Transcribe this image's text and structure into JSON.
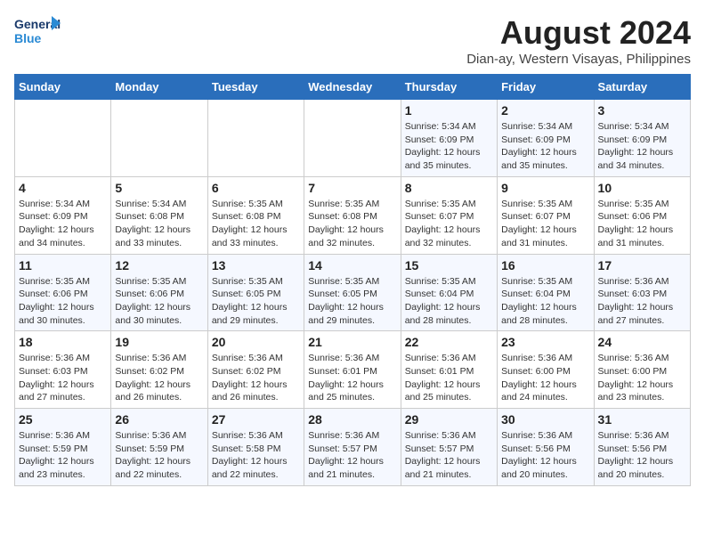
{
  "header": {
    "logo_line1": "General",
    "logo_line2": "Blue",
    "title": "August 2024",
    "subtitle": "Dian-ay, Western Visayas, Philippines"
  },
  "days_of_week": [
    "Sunday",
    "Monday",
    "Tuesday",
    "Wednesday",
    "Thursday",
    "Friday",
    "Saturday"
  ],
  "weeks": [
    [
      {
        "date": "",
        "info": ""
      },
      {
        "date": "",
        "info": ""
      },
      {
        "date": "",
        "info": ""
      },
      {
        "date": "",
        "info": ""
      },
      {
        "date": "1",
        "info": "Sunrise: 5:34 AM\nSunset: 6:09 PM\nDaylight: 12 hours\nand 35 minutes."
      },
      {
        "date": "2",
        "info": "Sunrise: 5:34 AM\nSunset: 6:09 PM\nDaylight: 12 hours\nand 35 minutes."
      },
      {
        "date": "3",
        "info": "Sunrise: 5:34 AM\nSunset: 6:09 PM\nDaylight: 12 hours\nand 34 minutes."
      }
    ],
    [
      {
        "date": "4",
        "info": "Sunrise: 5:34 AM\nSunset: 6:09 PM\nDaylight: 12 hours\nand 34 minutes."
      },
      {
        "date": "5",
        "info": "Sunrise: 5:34 AM\nSunset: 6:08 PM\nDaylight: 12 hours\nand 33 minutes."
      },
      {
        "date": "6",
        "info": "Sunrise: 5:35 AM\nSunset: 6:08 PM\nDaylight: 12 hours\nand 33 minutes."
      },
      {
        "date": "7",
        "info": "Sunrise: 5:35 AM\nSunset: 6:08 PM\nDaylight: 12 hours\nand 32 minutes."
      },
      {
        "date": "8",
        "info": "Sunrise: 5:35 AM\nSunset: 6:07 PM\nDaylight: 12 hours\nand 32 minutes."
      },
      {
        "date": "9",
        "info": "Sunrise: 5:35 AM\nSunset: 6:07 PM\nDaylight: 12 hours\nand 31 minutes."
      },
      {
        "date": "10",
        "info": "Sunrise: 5:35 AM\nSunset: 6:06 PM\nDaylight: 12 hours\nand 31 minutes."
      }
    ],
    [
      {
        "date": "11",
        "info": "Sunrise: 5:35 AM\nSunset: 6:06 PM\nDaylight: 12 hours\nand 30 minutes."
      },
      {
        "date": "12",
        "info": "Sunrise: 5:35 AM\nSunset: 6:06 PM\nDaylight: 12 hours\nand 30 minutes."
      },
      {
        "date": "13",
        "info": "Sunrise: 5:35 AM\nSunset: 6:05 PM\nDaylight: 12 hours\nand 29 minutes."
      },
      {
        "date": "14",
        "info": "Sunrise: 5:35 AM\nSunset: 6:05 PM\nDaylight: 12 hours\nand 29 minutes."
      },
      {
        "date": "15",
        "info": "Sunrise: 5:35 AM\nSunset: 6:04 PM\nDaylight: 12 hours\nand 28 minutes."
      },
      {
        "date": "16",
        "info": "Sunrise: 5:35 AM\nSunset: 6:04 PM\nDaylight: 12 hours\nand 28 minutes."
      },
      {
        "date": "17",
        "info": "Sunrise: 5:36 AM\nSunset: 6:03 PM\nDaylight: 12 hours\nand 27 minutes."
      }
    ],
    [
      {
        "date": "18",
        "info": "Sunrise: 5:36 AM\nSunset: 6:03 PM\nDaylight: 12 hours\nand 27 minutes."
      },
      {
        "date": "19",
        "info": "Sunrise: 5:36 AM\nSunset: 6:02 PM\nDaylight: 12 hours\nand 26 minutes."
      },
      {
        "date": "20",
        "info": "Sunrise: 5:36 AM\nSunset: 6:02 PM\nDaylight: 12 hours\nand 26 minutes."
      },
      {
        "date": "21",
        "info": "Sunrise: 5:36 AM\nSunset: 6:01 PM\nDaylight: 12 hours\nand 25 minutes."
      },
      {
        "date": "22",
        "info": "Sunrise: 5:36 AM\nSunset: 6:01 PM\nDaylight: 12 hours\nand 25 minutes."
      },
      {
        "date": "23",
        "info": "Sunrise: 5:36 AM\nSunset: 6:00 PM\nDaylight: 12 hours\nand 24 minutes."
      },
      {
        "date": "24",
        "info": "Sunrise: 5:36 AM\nSunset: 6:00 PM\nDaylight: 12 hours\nand 23 minutes."
      }
    ],
    [
      {
        "date": "25",
        "info": "Sunrise: 5:36 AM\nSunset: 5:59 PM\nDaylight: 12 hours\nand 23 minutes."
      },
      {
        "date": "26",
        "info": "Sunrise: 5:36 AM\nSunset: 5:59 PM\nDaylight: 12 hours\nand 22 minutes."
      },
      {
        "date": "27",
        "info": "Sunrise: 5:36 AM\nSunset: 5:58 PM\nDaylight: 12 hours\nand 22 minutes."
      },
      {
        "date": "28",
        "info": "Sunrise: 5:36 AM\nSunset: 5:57 PM\nDaylight: 12 hours\nand 21 minutes."
      },
      {
        "date": "29",
        "info": "Sunrise: 5:36 AM\nSunset: 5:57 PM\nDaylight: 12 hours\nand 21 minutes."
      },
      {
        "date": "30",
        "info": "Sunrise: 5:36 AM\nSunset: 5:56 PM\nDaylight: 12 hours\nand 20 minutes."
      },
      {
        "date": "31",
        "info": "Sunrise: 5:36 AM\nSunset: 5:56 PM\nDaylight: 12 hours\nand 20 minutes."
      }
    ]
  ]
}
